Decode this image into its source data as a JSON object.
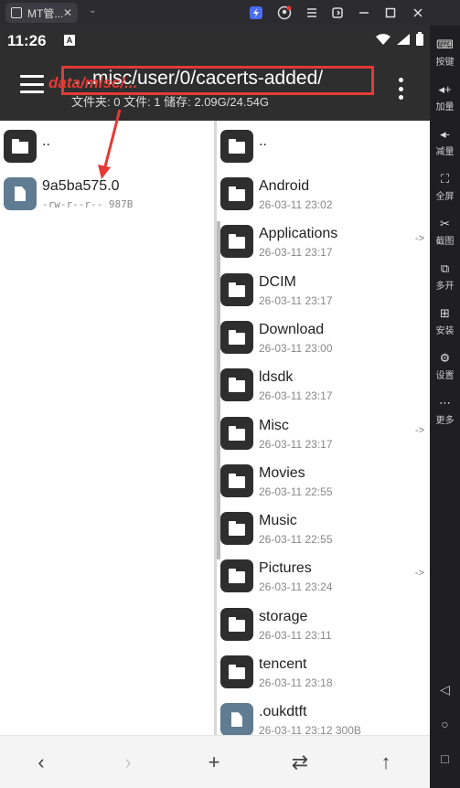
{
  "window": {
    "tab_title": "MT管...",
    "tab_close": "✕",
    "tab_menu_glyph": "⌄",
    "controls": [
      "app-badge-icon",
      "account-icon",
      "menu-icon",
      "pin-icon",
      "minimize-icon",
      "maximize-icon",
      "close-icon"
    ]
  },
  "status": {
    "time": "11:26",
    "badge": "A"
  },
  "toolbar": {
    "path": "…misc/user/0/cacerts-added/",
    "info": "文件夹: 0  文件: 1  储存: 2.09G/24.54G",
    "annotation": "data/misc/...",
    "annotation_color": "#e53935"
  },
  "left_pane": {
    "parent": "..",
    "files": [
      {
        "name": "9a5ba575.0",
        "meta": "-rw-r--r-- 987B"
      }
    ]
  },
  "right_pane": {
    "parent": "..",
    "items": [
      {
        "name": "Android",
        "date": "26-03-11 23:02",
        "link": ""
      },
      {
        "name": "Applications",
        "date": "26-03-11 23:17",
        "link": "->"
      },
      {
        "name": "DCIM",
        "date": "26-03-11 23:17",
        "link": ""
      },
      {
        "name": "Download",
        "date": "26-03-11 23:00",
        "link": ""
      },
      {
        "name": "ldsdk",
        "date": "26-03-11 23:17",
        "link": ""
      },
      {
        "name": "Misc",
        "date": "26-03-11 23:17",
        "link": "->"
      },
      {
        "name": "Movies",
        "date": "26-03-11 22:55",
        "link": ""
      },
      {
        "name": "Music",
        "date": "26-03-11 22:55",
        "link": ""
      },
      {
        "name": "Pictures",
        "date": "26-03-11 23:24",
        "link": "->"
      },
      {
        "name": "storage",
        "date": "26-03-11 23:11",
        "link": ""
      },
      {
        "name": "tencent",
        "date": "26-03-11 23:18",
        "link": ""
      },
      {
        "name": ".oukdtft",
        "date": "26-03-11 23:12  300B",
        "link": "",
        "file": true
      }
    ]
  },
  "bottom_bar": {
    "back": "‹",
    "forward": "›",
    "add": "+",
    "swap": "⇄",
    "up": "↑"
  },
  "side_panel": {
    "items": [
      {
        "label": "按键",
        "icon": "keyboard-icon"
      },
      {
        "label": "加量",
        "icon": "volume-up-icon"
      },
      {
        "label": "减量",
        "icon": "volume-down-icon"
      },
      {
        "label": "全屏",
        "icon": "fullscreen-icon"
      },
      {
        "label": "截图",
        "icon": "scissors-icon"
      },
      {
        "label": "多开",
        "icon": "multi-instance-icon"
      },
      {
        "label": "安装",
        "icon": "apk-icon"
      },
      {
        "label": "设置",
        "icon": "settings-icon"
      },
      {
        "label": "更多",
        "icon": "more-icon"
      }
    ],
    "nav": [
      "◁",
      "○",
      "□"
    ]
  }
}
